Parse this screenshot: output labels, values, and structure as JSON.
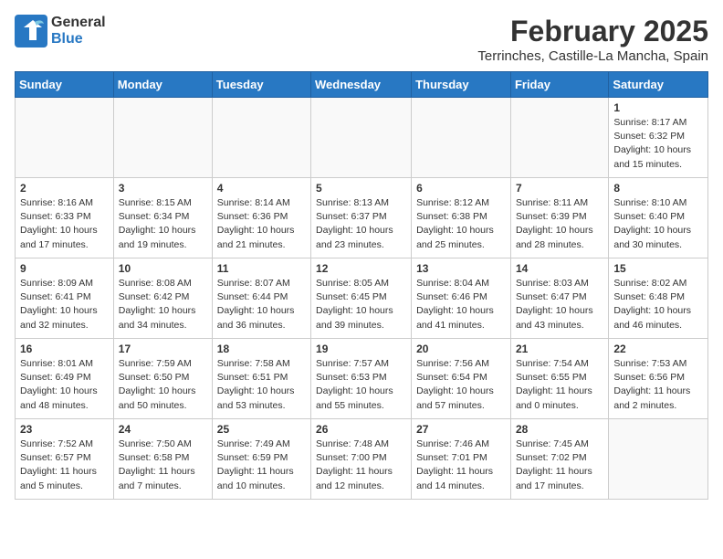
{
  "header": {
    "logo_general": "General",
    "logo_blue": "Blue",
    "month_year": "February 2025",
    "location": "Terrinches, Castille-La Mancha, Spain"
  },
  "weekdays": [
    "Sunday",
    "Monday",
    "Tuesday",
    "Wednesday",
    "Thursday",
    "Friday",
    "Saturday"
  ],
  "weeks": [
    [
      {
        "day": "",
        "info": ""
      },
      {
        "day": "",
        "info": ""
      },
      {
        "day": "",
        "info": ""
      },
      {
        "day": "",
        "info": ""
      },
      {
        "day": "",
        "info": ""
      },
      {
        "day": "",
        "info": ""
      },
      {
        "day": "1",
        "info": "Sunrise: 8:17 AM\nSunset: 6:32 PM\nDaylight: 10 hours\nand 15 minutes."
      }
    ],
    [
      {
        "day": "2",
        "info": "Sunrise: 8:16 AM\nSunset: 6:33 PM\nDaylight: 10 hours\nand 17 minutes."
      },
      {
        "day": "3",
        "info": "Sunrise: 8:15 AM\nSunset: 6:34 PM\nDaylight: 10 hours\nand 19 minutes."
      },
      {
        "day": "4",
        "info": "Sunrise: 8:14 AM\nSunset: 6:36 PM\nDaylight: 10 hours\nand 21 minutes."
      },
      {
        "day": "5",
        "info": "Sunrise: 8:13 AM\nSunset: 6:37 PM\nDaylight: 10 hours\nand 23 minutes."
      },
      {
        "day": "6",
        "info": "Sunrise: 8:12 AM\nSunset: 6:38 PM\nDaylight: 10 hours\nand 25 minutes."
      },
      {
        "day": "7",
        "info": "Sunrise: 8:11 AM\nSunset: 6:39 PM\nDaylight: 10 hours\nand 28 minutes."
      },
      {
        "day": "8",
        "info": "Sunrise: 8:10 AM\nSunset: 6:40 PM\nDaylight: 10 hours\nand 30 minutes."
      }
    ],
    [
      {
        "day": "9",
        "info": "Sunrise: 8:09 AM\nSunset: 6:41 PM\nDaylight: 10 hours\nand 32 minutes."
      },
      {
        "day": "10",
        "info": "Sunrise: 8:08 AM\nSunset: 6:42 PM\nDaylight: 10 hours\nand 34 minutes."
      },
      {
        "day": "11",
        "info": "Sunrise: 8:07 AM\nSunset: 6:44 PM\nDaylight: 10 hours\nand 36 minutes."
      },
      {
        "day": "12",
        "info": "Sunrise: 8:05 AM\nSunset: 6:45 PM\nDaylight: 10 hours\nand 39 minutes."
      },
      {
        "day": "13",
        "info": "Sunrise: 8:04 AM\nSunset: 6:46 PM\nDaylight: 10 hours\nand 41 minutes."
      },
      {
        "day": "14",
        "info": "Sunrise: 8:03 AM\nSunset: 6:47 PM\nDaylight: 10 hours\nand 43 minutes."
      },
      {
        "day": "15",
        "info": "Sunrise: 8:02 AM\nSunset: 6:48 PM\nDaylight: 10 hours\nand 46 minutes."
      }
    ],
    [
      {
        "day": "16",
        "info": "Sunrise: 8:01 AM\nSunset: 6:49 PM\nDaylight: 10 hours\nand 48 minutes."
      },
      {
        "day": "17",
        "info": "Sunrise: 7:59 AM\nSunset: 6:50 PM\nDaylight: 10 hours\nand 50 minutes."
      },
      {
        "day": "18",
        "info": "Sunrise: 7:58 AM\nSunset: 6:51 PM\nDaylight: 10 hours\nand 53 minutes."
      },
      {
        "day": "19",
        "info": "Sunrise: 7:57 AM\nSunset: 6:53 PM\nDaylight: 10 hours\nand 55 minutes."
      },
      {
        "day": "20",
        "info": "Sunrise: 7:56 AM\nSunset: 6:54 PM\nDaylight: 10 hours\nand 57 minutes."
      },
      {
        "day": "21",
        "info": "Sunrise: 7:54 AM\nSunset: 6:55 PM\nDaylight: 11 hours\nand 0 minutes."
      },
      {
        "day": "22",
        "info": "Sunrise: 7:53 AM\nSunset: 6:56 PM\nDaylight: 11 hours\nand 2 minutes."
      }
    ],
    [
      {
        "day": "23",
        "info": "Sunrise: 7:52 AM\nSunset: 6:57 PM\nDaylight: 11 hours\nand 5 minutes."
      },
      {
        "day": "24",
        "info": "Sunrise: 7:50 AM\nSunset: 6:58 PM\nDaylight: 11 hours\nand 7 minutes."
      },
      {
        "day": "25",
        "info": "Sunrise: 7:49 AM\nSunset: 6:59 PM\nDaylight: 11 hours\nand 10 minutes."
      },
      {
        "day": "26",
        "info": "Sunrise: 7:48 AM\nSunset: 7:00 PM\nDaylight: 11 hours\nand 12 minutes."
      },
      {
        "day": "27",
        "info": "Sunrise: 7:46 AM\nSunset: 7:01 PM\nDaylight: 11 hours\nand 14 minutes."
      },
      {
        "day": "28",
        "info": "Sunrise: 7:45 AM\nSunset: 7:02 PM\nDaylight: 11 hours\nand 17 minutes."
      },
      {
        "day": "",
        "info": ""
      }
    ]
  ]
}
